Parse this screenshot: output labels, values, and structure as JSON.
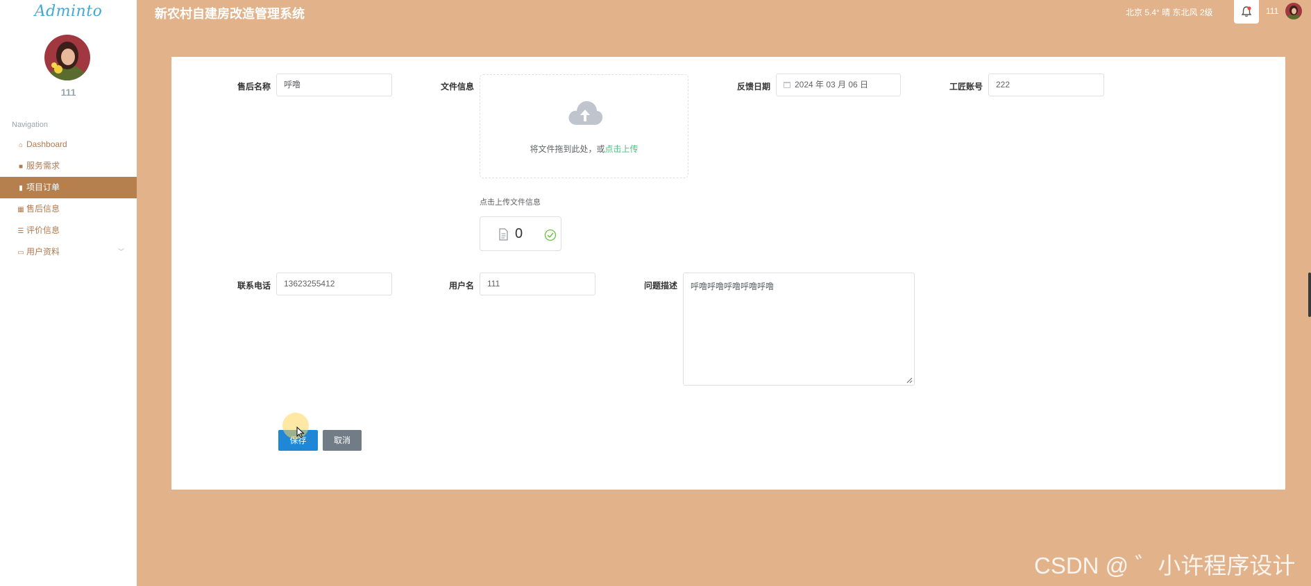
{
  "sidebar": {
    "logo": "Adminto",
    "username": "111",
    "nav_title": "Navigation",
    "items": [
      {
        "label": "Dashboard",
        "icon": "home-icon"
      },
      {
        "label": "服务需求",
        "icon": "briefcase-icon"
      },
      {
        "label": "项目订单",
        "icon": "clipboard-icon",
        "active": true
      },
      {
        "label": "售后信息",
        "icon": "grid-icon"
      },
      {
        "label": "评价信息",
        "icon": "sliders-icon"
      },
      {
        "label": "用户资料",
        "icon": "calendar-icon"
      }
    ]
  },
  "header": {
    "title": "新农村自建房改造管理系统",
    "weather": "北京  5.4°  晴  东北风  2级",
    "user": "111"
  },
  "form": {
    "name_label": "售后名称",
    "name_value": "呼噜",
    "file_label": "文件信息",
    "upload_text": "将文件拖到此处，或",
    "upload_link": "点击上传",
    "upload_tip": "点击上传文件信息",
    "file_count": "0",
    "date_label": "反馈日期",
    "date_value": "2024 年 03 月 06 日",
    "worker_label": "工匠账号",
    "worker_value": "222",
    "phone_label": "联系电话",
    "phone_value": "13623255412",
    "user_label": "用户名",
    "user_value": "111",
    "desc_label": "问题描述",
    "desc_value": "呼噜呼噜呼噜呼噜呼噜",
    "save_label": "保存",
    "cancel_label": "取消"
  },
  "watermark": "CSDN @ ゛小许程序设计",
  "colors": {
    "background": "#e2b38b",
    "active_nav": "#b6804e",
    "primary_button": "#1f87d6",
    "cancel_button": "#717c86",
    "upload_link": "#3ec57b"
  }
}
